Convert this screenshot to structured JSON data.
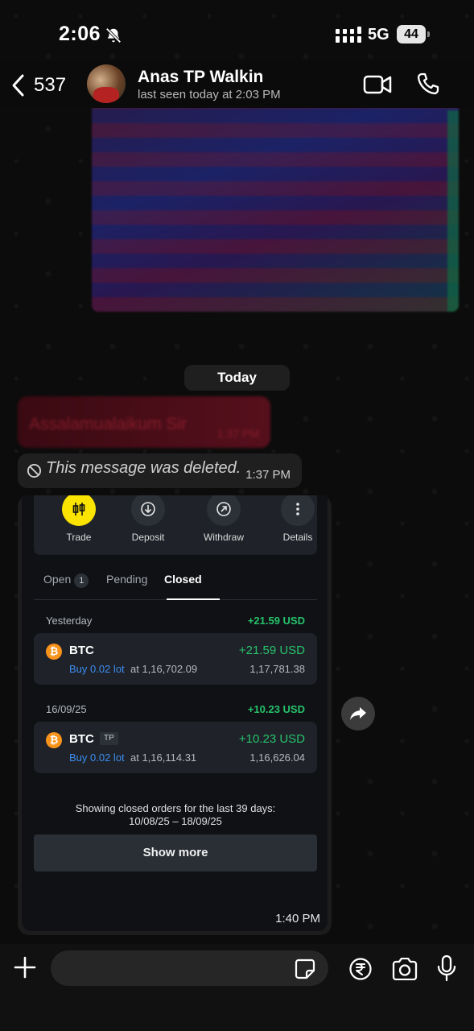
{
  "status_bar": {
    "time": "2:06",
    "network": "5G",
    "battery": "44"
  },
  "header": {
    "back_count": "537",
    "contact_name": "Anas TP Walkin",
    "contact_status": "last seen today at 2:03 PM"
  },
  "date_chip": "Today",
  "redacted_message": {
    "text": "Assalamualaikum Sir",
    "time": "1:37 PM"
  },
  "deleted_message": {
    "text": "This message was deleted.",
    "time": "1:37 PM"
  },
  "image_message": {
    "time": "1:40 PM",
    "actions": [
      {
        "label": "Trade",
        "icon": "candlestick-icon"
      },
      {
        "label": "Deposit",
        "icon": "arrow-down-circle-icon"
      },
      {
        "label": "Withdraw",
        "icon": "arrow-up-right-circle-icon"
      },
      {
        "label": "Details",
        "icon": "more-vertical-icon"
      }
    ],
    "tabs": {
      "open": "Open",
      "open_count": "1",
      "pending": "Pending",
      "closed": "Closed"
    },
    "groups": [
      {
        "date": "Yesterday",
        "total": "+21.59 USD",
        "orders": [
          {
            "symbol": "BTC",
            "tp": "",
            "side": "Buy 0.02 lot",
            "at": "at 1,16,702.09",
            "profit": "+21.59 USD",
            "close": "1,17,781.38"
          }
        ]
      },
      {
        "date": "16/09/25",
        "total": "+10.23 USD",
        "orders": [
          {
            "symbol": "BTC",
            "tp": "TP",
            "side": "Buy 0.02 lot",
            "at": "at 1,16,114.31",
            "profit": "+10.23 USD",
            "close": "1,16,626.04"
          }
        ]
      }
    ],
    "closed_note_line1": "Showing closed orders for the last 39 days:",
    "closed_note_line2": "10/08/25 – 18/09/25",
    "show_more": "Show more"
  },
  "input_bar": {
    "placeholder": ""
  },
  "colors": {
    "profit_green": "#27c26b",
    "buy_blue": "#3b8cf0",
    "trade_yellow": "#fbe400",
    "bitcoin_orange": "#f7931a"
  }
}
